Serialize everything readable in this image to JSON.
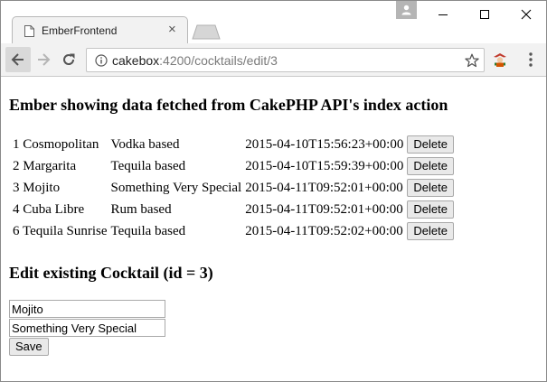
{
  "browser": {
    "tab_title": "EmberFrontend",
    "tab_close": "×",
    "url_host": "cakebox",
    "url_rest": ":4200/cocktails/edit/3"
  },
  "page": {
    "list_heading": "Ember showing data fetched from CakePHP API's index action",
    "cocktails": [
      {
        "id": "1",
        "name": "Cosmopolitan",
        "description": "Vodka based",
        "created": "2015-04-10T15:56:23+00:00"
      },
      {
        "id": "2",
        "name": "Margarita",
        "description": "Tequila based",
        "created": "2015-04-10T15:59:39+00:00"
      },
      {
        "id": "3",
        "name": "Mojito",
        "description": "Something Very Special",
        "created": "2015-04-11T09:52:01+00:00"
      },
      {
        "id": "4",
        "name": "Cuba Libre",
        "description": "Rum based",
        "created": "2015-04-11T09:52:01+00:00"
      },
      {
        "id": "6",
        "name": "Tequila Sunrise",
        "description": "Tequila based",
        "created": "2015-04-11T09:52:02+00:00"
      }
    ],
    "delete_label": "Delete",
    "edit_heading": "Edit existing Cocktail (id = 3)",
    "edit_form": {
      "name_value": "Mojito",
      "description_value": "Something Very Special",
      "save_label": "Save"
    }
  }
}
